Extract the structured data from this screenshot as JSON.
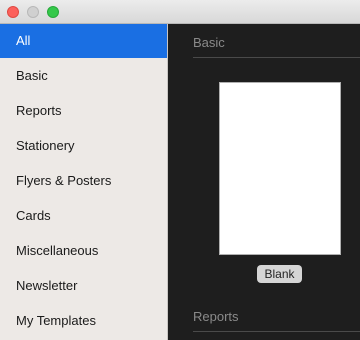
{
  "window": {
    "controls": [
      "close",
      "minimize",
      "zoom"
    ]
  },
  "sidebar": {
    "items": [
      {
        "label": "All",
        "selected": true
      },
      {
        "label": "Basic",
        "selected": false
      },
      {
        "label": "Reports",
        "selected": false
      },
      {
        "label": "Stationery",
        "selected": false
      },
      {
        "label": "Flyers & Posters",
        "selected": false
      },
      {
        "label": "Cards",
        "selected": false
      },
      {
        "label": "Miscellaneous",
        "selected": false
      },
      {
        "label": "Newsletter",
        "selected": false
      },
      {
        "label": "My Templates",
        "selected": false
      }
    ]
  },
  "main": {
    "sections": [
      {
        "title": "Basic"
      },
      {
        "title": "Reports"
      }
    ],
    "templates": [
      {
        "name": "Blank"
      }
    ]
  },
  "colors": {
    "selection": "#1a6fe3",
    "sidebar_bg": "#ede9e6",
    "content_bg": "#1e1e1e",
    "close": "#fc605b",
    "zoom": "#34c84a"
  }
}
